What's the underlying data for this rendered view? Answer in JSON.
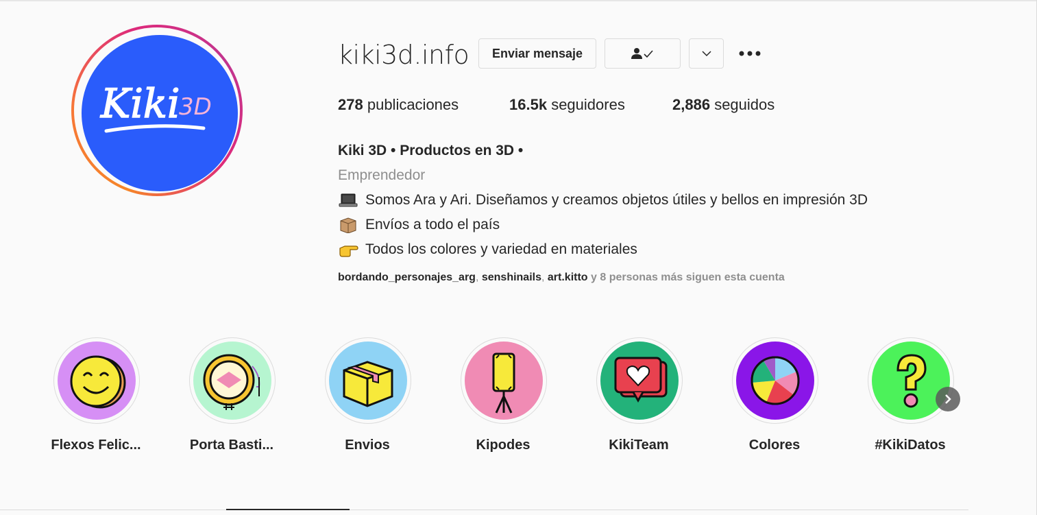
{
  "profile": {
    "username": "kiki3d.info",
    "avatar_text": "Kiki 3D",
    "message_button": "Enviar mensaje",
    "follow_icon": "person-check-icon",
    "dropdown_icon": "chevron-down-icon",
    "more_icon": "more-dots-icon"
  },
  "stats": {
    "posts_count": "278",
    "posts_label": "publicaciones",
    "followers_count": "16.5k",
    "followers_label": "seguidores",
    "following_count": "2,886",
    "following_label": "seguidos"
  },
  "bio": {
    "name": "Kiki 3D • Productos en 3D •",
    "category": "Emprendedor",
    "lines": [
      {
        "icon": "laptop-emoji",
        "text": "Somos Ara y Ari. Diseñamos y creamos objetos útiles y bellos en impresión 3D"
      },
      {
        "icon": "package-emoji",
        "text": "Envíos a todo el país"
      },
      {
        "icon": "pointing-hand-emoji",
        "text": "Todos los colores y variedad en materiales"
      }
    ]
  },
  "followed_by": {
    "accounts": [
      "bordando_personajes_arg",
      "senshinails",
      "art.kitto"
    ],
    "tail": "y 8 personas más siguen esta cuenta"
  },
  "highlights": [
    {
      "label": "Flexos Felic...",
      "icon": "smiley-icon",
      "color": "#d68ff5"
    },
    {
      "label": "Porta Basti...",
      "icon": "embroidery-hoop-icon",
      "color": "#b6f5d0"
    },
    {
      "label": "Envios",
      "icon": "box-icon",
      "color": "#8fd3f5"
    },
    {
      "label": "Kipodes",
      "icon": "phone-tripod-icon",
      "color": "#f08bb4"
    },
    {
      "label": "KikiTeam",
      "icon": "heart-chat-icon",
      "color": "#23b27a"
    },
    {
      "label": "Colores",
      "icon": "color-wheel-icon",
      "color": "#8a16e8"
    },
    {
      "label": "#KikiDatos",
      "icon": "question-mark-icon",
      "color": "#4cf25a"
    }
  ],
  "next_icon": "chevron-right-icon"
}
